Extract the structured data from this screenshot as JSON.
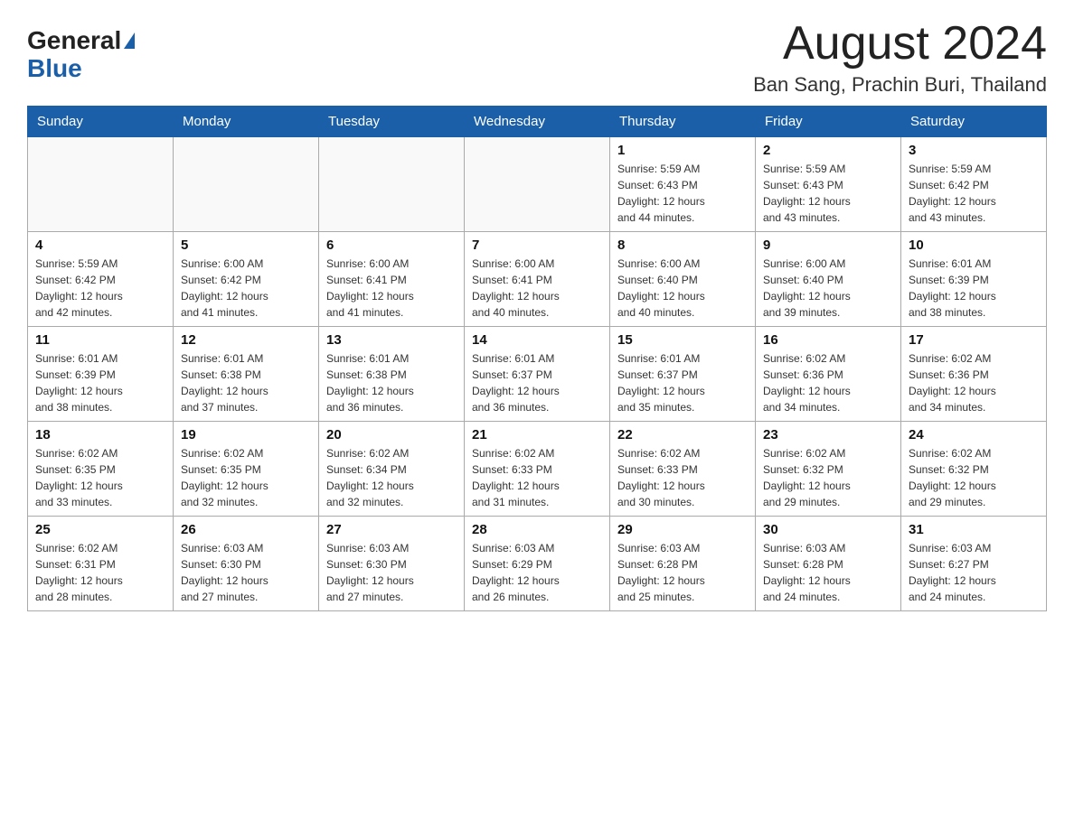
{
  "header": {
    "logo_general": "General",
    "logo_blue": "Blue",
    "title": "August 2024",
    "subtitle": "Ban Sang, Prachin Buri, Thailand"
  },
  "calendar": {
    "days_of_week": [
      "Sunday",
      "Monday",
      "Tuesday",
      "Wednesday",
      "Thursday",
      "Friday",
      "Saturday"
    ],
    "weeks": [
      [
        {
          "day": "",
          "info": ""
        },
        {
          "day": "",
          "info": ""
        },
        {
          "day": "",
          "info": ""
        },
        {
          "day": "",
          "info": ""
        },
        {
          "day": "1",
          "info": "Sunrise: 5:59 AM\nSunset: 6:43 PM\nDaylight: 12 hours\nand 44 minutes."
        },
        {
          "day": "2",
          "info": "Sunrise: 5:59 AM\nSunset: 6:43 PM\nDaylight: 12 hours\nand 43 minutes."
        },
        {
          "day": "3",
          "info": "Sunrise: 5:59 AM\nSunset: 6:42 PM\nDaylight: 12 hours\nand 43 minutes."
        }
      ],
      [
        {
          "day": "4",
          "info": "Sunrise: 5:59 AM\nSunset: 6:42 PM\nDaylight: 12 hours\nand 42 minutes."
        },
        {
          "day": "5",
          "info": "Sunrise: 6:00 AM\nSunset: 6:42 PM\nDaylight: 12 hours\nand 41 minutes."
        },
        {
          "day": "6",
          "info": "Sunrise: 6:00 AM\nSunset: 6:41 PM\nDaylight: 12 hours\nand 41 minutes."
        },
        {
          "day": "7",
          "info": "Sunrise: 6:00 AM\nSunset: 6:41 PM\nDaylight: 12 hours\nand 40 minutes."
        },
        {
          "day": "8",
          "info": "Sunrise: 6:00 AM\nSunset: 6:40 PM\nDaylight: 12 hours\nand 40 minutes."
        },
        {
          "day": "9",
          "info": "Sunrise: 6:00 AM\nSunset: 6:40 PM\nDaylight: 12 hours\nand 39 minutes."
        },
        {
          "day": "10",
          "info": "Sunrise: 6:01 AM\nSunset: 6:39 PM\nDaylight: 12 hours\nand 38 minutes."
        }
      ],
      [
        {
          "day": "11",
          "info": "Sunrise: 6:01 AM\nSunset: 6:39 PM\nDaylight: 12 hours\nand 38 minutes."
        },
        {
          "day": "12",
          "info": "Sunrise: 6:01 AM\nSunset: 6:38 PM\nDaylight: 12 hours\nand 37 minutes."
        },
        {
          "day": "13",
          "info": "Sunrise: 6:01 AM\nSunset: 6:38 PM\nDaylight: 12 hours\nand 36 minutes."
        },
        {
          "day": "14",
          "info": "Sunrise: 6:01 AM\nSunset: 6:37 PM\nDaylight: 12 hours\nand 36 minutes."
        },
        {
          "day": "15",
          "info": "Sunrise: 6:01 AM\nSunset: 6:37 PM\nDaylight: 12 hours\nand 35 minutes."
        },
        {
          "day": "16",
          "info": "Sunrise: 6:02 AM\nSunset: 6:36 PM\nDaylight: 12 hours\nand 34 minutes."
        },
        {
          "day": "17",
          "info": "Sunrise: 6:02 AM\nSunset: 6:36 PM\nDaylight: 12 hours\nand 34 minutes."
        }
      ],
      [
        {
          "day": "18",
          "info": "Sunrise: 6:02 AM\nSunset: 6:35 PM\nDaylight: 12 hours\nand 33 minutes."
        },
        {
          "day": "19",
          "info": "Sunrise: 6:02 AM\nSunset: 6:35 PM\nDaylight: 12 hours\nand 32 minutes."
        },
        {
          "day": "20",
          "info": "Sunrise: 6:02 AM\nSunset: 6:34 PM\nDaylight: 12 hours\nand 32 minutes."
        },
        {
          "day": "21",
          "info": "Sunrise: 6:02 AM\nSunset: 6:33 PM\nDaylight: 12 hours\nand 31 minutes."
        },
        {
          "day": "22",
          "info": "Sunrise: 6:02 AM\nSunset: 6:33 PM\nDaylight: 12 hours\nand 30 minutes."
        },
        {
          "day": "23",
          "info": "Sunrise: 6:02 AM\nSunset: 6:32 PM\nDaylight: 12 hours\nand 29 minutes."
        },
        {
          "day": "24",
          "info": "Sunrise: 6:02 AM\nSunset: 6:32 PM\nDaylight: 12 hours\nand 29 minutes."
        }
      ],
      [
        {
          "day": "25",
          "info": "Sunrise: 6:02 AM\nSunset: 6:31 PM\nDaylight: 12 hours\nand 28 minutes."
        },
        {
          "day": "26",
          "info": "Sunrise: 6:03 AM\nSunset: 6:30 PM\nDaylight: 12 hours\nand 27 minutes."
        },
        {
          "day": "27",
          "info": "Sunrise: 6:03 AM\nSunset: 6:30 PM\nDaylight: 12 hours\nand 27 minutes."
        },
        {
          "day": "28",
          "info": "Sunrise: 6:03 AM\nSunset: 6:29 PM\nDaylight: 12 hours\nand 26 minutes."
        },
        {
          "day": "29",
          "info": "Sunrise: 6:03 AM\nSunset: 6:28 PM\nDaylight: 12 hours\nand 25 minutes."
        },
        {
          "day": "30",
          "info": "Sunrise: 6:03 AM\nSunset: 6:28 PM\nDaylight: 12 hours\nand 24 minutes."
        },
        {
          "day": "31",
          "info": "Sunrise: 6:03 AM\nSunset: 6:27 PM\nDaylight: 12 hours\nand 24 minutes."
        }
      ]
    ]
  }
}
